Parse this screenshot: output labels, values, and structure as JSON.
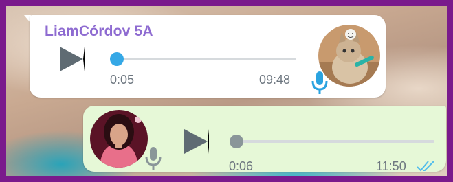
{
  "chat": {
    "incoming": {
      "sender_name": "LiamCórdov 5A",
      "current_time": "0:05",
      "timestamp": "09:48",
      "progress": 0.0,
      "play_icon": "play-icon",
      "mic_icon": "microphone-icon",
      "mic_color": "#2aa3e0",
      "sender_color": "#8e6bd1",
      "knob_color": "#35a8e6"
    },
    "outgoing": {
      "current_time": "0:06",
      "timestamp": "11:50",
      "progress": 0.0,
      "status": "read",
      "play_icon": "play-icon",
      "mic_icon": "microphone-icon",
      "mic_color": "#8a9699",
      "ticks_icon": "double-check-icon",
      "ticks_color": "#53bdeb",
      "knob_color": "#8a9699",
      "bubble_color": "#e6f8d7"
    }
  },
  "colors": {
    "frame_border": "#7a1a8c",
    "incoming_bubble": "#ffffff"
  }
}
